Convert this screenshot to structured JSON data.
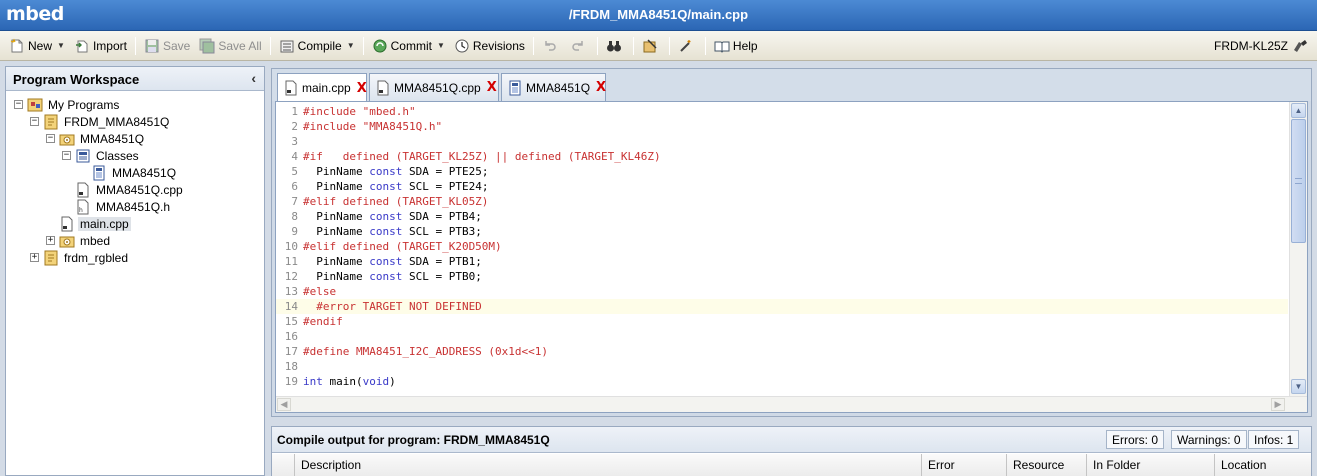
{
  "app": {
    "logo": "mbed",
    "title": "/FRDM_MMA8451Q/main.cpp"
  },
  "toolbar": {
    "new": "New",
    "import": "Import",
    "save": "Save",
    "save_all": "Save All",
    "compile": "Compile",
    "commit": "Commit",
    "revisions": "Revisions",
    "help": "Help",
    "target": "FRDM-KL25Z"
  },
  "workspace": {
    "title": "Program Workspace",
    "tree": [
      {
        "label": "My Programs",
        "depth": 0,
        "toggle": "-",
        "icon": "programs-icon"
      },
      {
        "label": "FRDM_MMA8451Q",
        "depth": 1,
        "toggle": "-",
        "icon": "program-icon"
      },
      {
        "label": "MMA8451Q",
        "depth": 2,
        "toggle": "-",
        "icon": "library-icon"
      },
      {
        "label": "Classes",
        "depth": 3,
        "toggle": "-",
        "icon": "classes-icon"
      },
      {
        "label": "MMA8451Q",
        "depth": 4,
        "toggle": "",
        "icon": "class-icon"
      },
      {
        "label": "MMA8451Q.cpp",
        "depth": 3,
        "toggle": "",
        "icon": "cpp-file-icon"
      },
      {
        "label": "MMA8451Q.h",
        "depth": 3,
        "toggle": "",
        "icon": "header-file-icon"
      },
      {
        "label": "main.cpp",
        "depth": 2,
        "toggle": "",
        "icon": "cpp-file-icon",
        "selected": true
      },
      {
        "label": "mbed",
        "depth": 2,
        "toggle": "+",
        "icon": "library-icon"
      },
      {
        "label": "frdm_rgbled",
        "depth": 1,
        "toggle": "+",
        "icon": "program-icon"
      }
    ]
  },
  "editor": {
    "tabs": [
      {
        "label": "main.cpp",
        "active": true,
        "close": "X"
      },
      {
        "label": "MMA8451Q.cpp",
        "active": false,
        "close": "X"
      },
      {
        "label": "MMA8451Q",
        "active": false,
        "close": "X"
      }
    ],
    "highlighted_line": 14,
    "lines": [
      [
        {
          "t": "#include \"mbed.h\"",
          "c": "pp"
        }
      ],
      [
        {
          "t": "#include \"MMA8451Q.h\"",
          "c": "pp"
        }
      ],
      [],
      [
        {
          "t": "#if   defined (TARGET_KL25Z) || defined (TARGET_KL46Z)",
          "c": "pp"
        }
      ],
      [
        {
          "t": "  PinName ",
          "c": "tx"
        },
        {
          "t": "const",
          "c": "kw"
        },
        {
          "t": " SDA = PTE25;",
          "c": "tx"
        }
      ],
      [
        {
          "t": "  PinName ",
          "c": "tx"
        },
        {
          "t": "const",
          "c": "kw"
        },
        {
          "t": " SCL = PTE24;",
          "c": "tx"
        }
      ],
      [
        {
          "t": "#elif defined (TARGET_KL05Z)",
          "c": "pp"
        }
      ],
      [
        {
          "t": "  PinName ",
          "c": "tx"
        },
        {
          "t": "const",
          "c": "kw"
        },
        {
          "t": " SDA = PTB4;",
          "c": "tx"
        }
      ],
      [
        {
          "t": "  PinName ",
          "c": "tx"
        },
        {
          "t": "const",
          "c": "kw"
        },
        {
          "t": " SCL = PTB3;",
          "c": "tx"
        }
      ],
      [
        {
          "t": "#elif defined (TARGET_K20D50M)",
          "c": "pp"
        }
      ],
      [
        {
          "t": "  PinName ",
          "c": "tx"
        },
        {
          "t": "const",
          "c": "kw"
        },
        {
          "t": " SDA = PTB1;",
          "c": "tx"
        }
      ],
      [
        {
          "t": "  PinName ",
          "c": "tx"
        },
        {
          "t": "const",
          "c": "kw"
        },
        {
          "t": " SCL = PTB0;",
          "c": "tx"
        }
      ],
      [
        {
          "t": "#else",
          "c": "pp"
        }
      ],
      [
        {
          "t": "  #error TARGET NOT DEFINED",
          "c": "pp"
        }
      ],
      [
        {
          "t": "#endif",
          "c": "pp"
        }
      ],
      [],
      [
        {
          "t": "#define MMA8451_I2C_ADDRESS (0x1d<<1)",
          "c": "pp"
        }
      ],
      [],
      [
        {
          "t": "int",
          "c": "kw"
        },
        {
          "t": " main(",
          "c": "tx"
        },
        {
          "t": "void",
          "c": "kw"
        },
        {
          "t": ")",
          "c": "tx"
        }
      ]
    ]
  },
  "compile": {
    "title": "Compile output for program: FRDM_MMA8451Q",
    "errors": "Errors: 0",
    "warnings": "Warnings: 0",
    "infos": "Infos: 1",
    "columns": [
      "Description",
      "Error",
      "Resource",
      "In Folder",
      "Location"
    ]
  },
  "colors": {
    "titlebar": "#2f6bbd",
    "preprocessor": "#c83232",
    "keyword": "#3a3ac8",
    "close_x": "#d40000"
  }
}
